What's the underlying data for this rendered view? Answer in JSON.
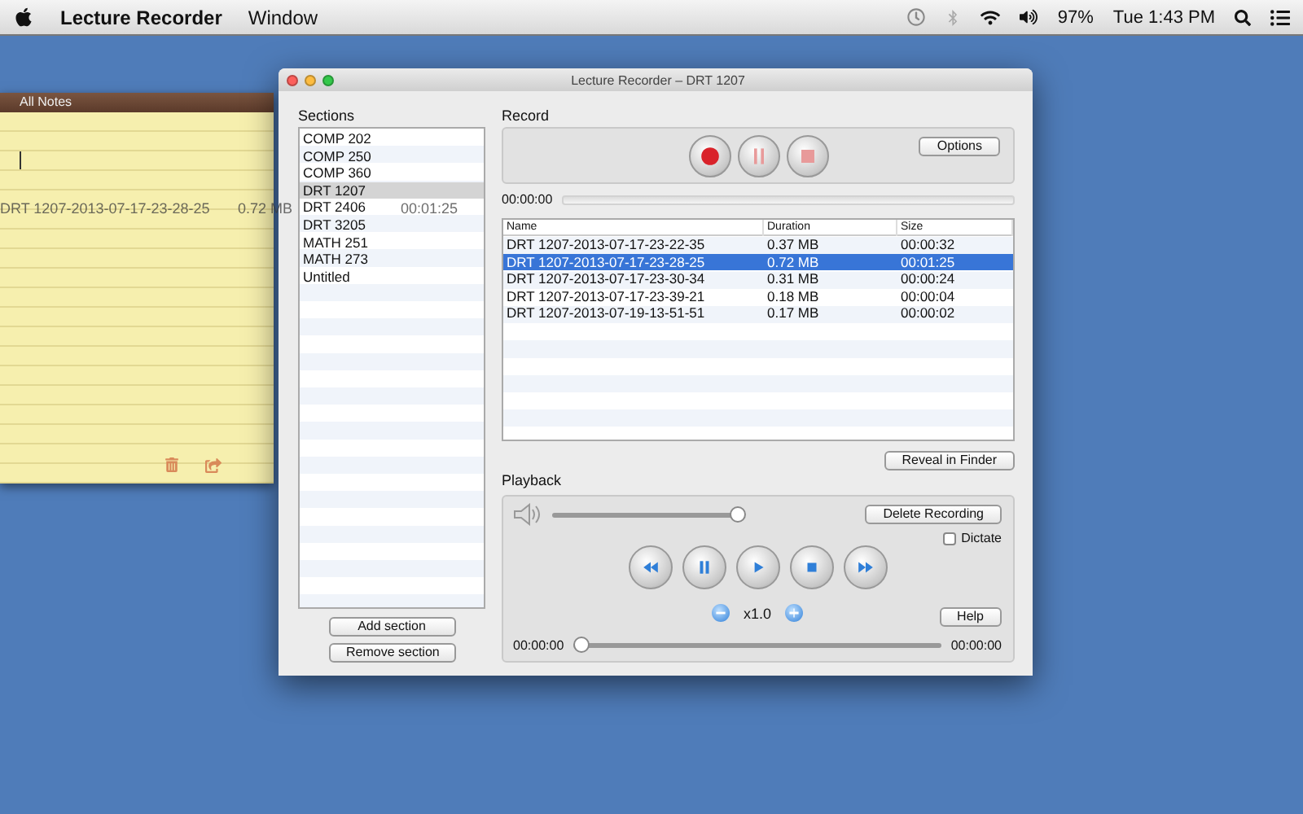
{
  "menubar": {
    "app_name": "Lecture Recorder",
    "menus": [
      "Window"
    ],
    "battery": "97%",
    "clock": "Tue 1:43 PM"
  },
  "notes_window": {
    "title": "All Notes"
  },
  "drag_ghost": {
    "name": "DRT 1207-2013-07-17-23-28-25",
    "duration": "0.72 MB",
    "size": "00:01:25"
  },
  "window": {
    "title": "Lecture Recorder – DRT 1207"
  },
  "sections": {
    "label": "Sections",
    "items": [
      {
        "label": "COMP 202",
        "selected": false
      },
      {
        "label": "COMP 250",
        "selected": false
      },
      {
        "label": "COMP 360",
        "selected": false
      },
      {
        "label": "DRT 1207",
        "selected": true
      },
      {
        "label": "DRT 2406",
        "selected": false
      },
      {
        "label": "DRT 3205",
        "selected": false
      },
      {
        "label": "MATH 251",
        "selected": false
      },
      {
        "label": "MATH 273",
        "selected": false
      },
      {
        "label": "Untitled",
        "selected": false
      }
    ],
    "buttons": [
      "Add section",
      "Remove section"
    ]
  },
  "record": {
    "label": "Record",
    "options_button": "Options",
    "elapsed": "00:00:00",
    "level": 0
  },
  "table": {
    "columns": [
      "Name",
      "Duration",
      "Size"
    ],
    "rows": [
      {
        "cells": [
          "DRT 1207-2013-07-17-23-22-35",
          "0.37 MB",
          "00:00:32"
        ],
        "selected": false
      },
      {
        "cells": [
          "DRT 1207-2013-07-17-23-28-25",
          "0.72 MB",
          "00:01:25"
        ],
        "selected": true
      },
      {
        "cells": [
          "DRT 1207-2013-07-17-23-30-34",
          "0.31 MB",
          "00:00:24"
        ],
        "selected": false
      },
      {
        "cells": [
          "DRT 1207-2013-07-17-23-39-21",
          "0.18 MB",
          "00:00:04"
        ],
        "selected": false
      },
      {
        "cells": [
          "DRT 1207-2013-07-19-13-51-51",
          "0.17 MB",
          "00:00:02"
        ],
        "selected": false
      }
    ]
  },
  "reveal_button": "Reveal in Finder",
  "playback": {
    "label": "Playback",
    "volume": {
      "level": 0.97
    },
    "delete_button": "Delete Recording",
    "dictate": {
      "label": "Dictate",
      "checked": false
    },
    "speed": "x1.0",
    "help_button": "Help",
    "position": {
      "start": "00:00:00",
      "end": "00:00:00",
      "level": 0
    }
  }
}
